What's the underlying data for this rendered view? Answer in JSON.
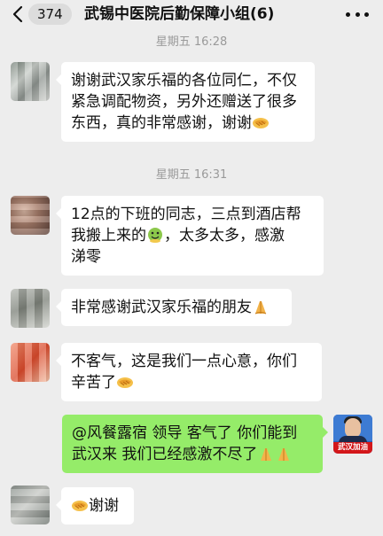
{
  "header": {
    "unread_count": "374",
    "title": "武锡中医院后勤保障小组(6)"
  },
  "colors": {
    "background": "#ededed",
    "bubble_incoming": "#ffffff",
    "bubble_outgoing": "#95ec69",
    "timestamp": "#9a9a9a"
  },
  "timestamps": [
    "星期五 16:28",
    "星期五 16:31"
  ],
  "messages": [
    {
      "side": "left",
      "lines": [
        "谢谢武汉家乐福的各位同仁，不仅",
        "紧急调配物资，另外还赠送了很多",
        "东西，真的非常感谢，谢谢"
      ],
      "emoji": "handshake"
    },
    {
      "side": "left",
      "lines": [
        "12点的下班的同志，三点到酒店帮",
        "我搬上来的",
        "，太多太多，感激",
        "涕零"
      ],
      "emoji": "face"
    },
    {
      "side": "left",
      "lines": [
        "非常感谢武汉家乐福的朋友"
      ],
      "emoji": "pray"
    },
    {
      "side": "left",
      "lines": [
        "不客气，这是我们一点心意，你们",
        "辛苦了"
      ],
      "emoji": "handshake"
    },
    {
      "side": "right",
      "lines": [
        "@风餐露宿 领导 客气了 你们能到",
        "武汉来 我们已经感激不尽了"
      ],
      "emoji": "pray-pray"
    },
    {
      "side": "left",
      "lines": [
        "谢谢"
      ],
      "emoji": "handshake"
    }
  ],
  "self_avatar_label": "武汉加油"
}
